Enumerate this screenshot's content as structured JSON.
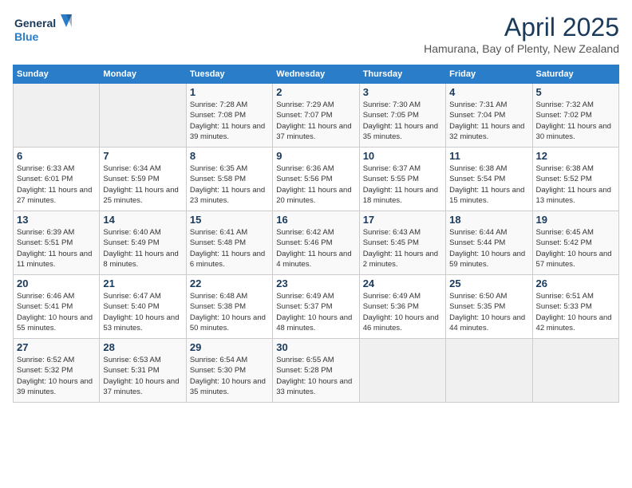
{
  "header": {
    "logo_line1": "General",
    "logo_line2": "Blue",
    "month": "April 2025",
    "location": "Hamurana, Bay of Plenty, New Zealand"
  },
  "days_of_week": [
    "Sunday",
    "Monday",
    "Tuesday",
    "Wednesday",
    "Thursday",
    "Friday",
    "Saturday"
  ],
  "weeks": [
    [
      {
        "day": "",
        "info": ""
      },
      {
        "day": "",
        "info": ""
      },
      {
        "day": "1",
        "info": "Sunrise: 7:28 AM\nSunset: 7:08 PM\nDaylight: 11 hours and 39 minutes."
      },
      {
        "day": "2",
        "info": "Sunrise: 7:29 AM\nSunset: 7:07 PM\nDaylight: 11 hours and 37 minutes."
      },
      {
        "day": "3",
        "info": "Sunrise: 7:30 AM\nSunset: 7:05 PM\nDaylight: 11 hours and 35 minutes."
      },
      {
        "day": "4",
        "info": "Sunrise: 7:31 AM\nSunset: 7:04 PM\nDaylight: 11 hours and 32 minutes."
      },
      {
        "day": "5",
        "info": "Sunrise: 7:32 AM\nSunset: 7:02 PM\nDaylight: 11 hours and 30 minutes."
      }
    ],
    [
      {
        "day": "6",
        "info": "Sunrise: 6:33 AM\nSunset: 6:01 PM\nDaylight: 11 hours and 27 minutes."
      },
      {
        "day": "7",
        "info": "Sunrise: 6:34 AM\nSunset: 5:59 PM\nDaylight: 11 hours and 25 minutes."
      },
      {
        "day": "8",
        "info": "Sunrise: 6:35 AM\nSunset: 5:58 PM\nDaylight: 11 hours and 23 minutes."
      },
      {
        "day": "9",
        "info": "Sunrise: 6:36 AM\nSunset: 5:56 PM\nDaylight: 11 hours and 20 minutes."
      },
      {
        "day": "10",
        "info": "Sunrise: 6:37 AM\nSunset: 5:55 PM\nDaylight: 11 hours and 18 minutes."
      },
      {
        "day": "11",
        "info": "Sunrise: 6:38 AM\nSunset: 5:54 PM\nDaylight: 11 hours and 15 minutes."
      },
      {
        "day": "12",
        "info": "Sunrise: 6:38 AM\nSunset: 5:52 PM\nDaylight: 11 hours and 13 minutes."
      }
    ],
    [
      {
        "day": "13",
        "info": "Sunrise: 6:39 AM\nSunset: 5:51 PM\nDaylight: 11 hours and 11 minutes."
      },
      {
        "day": "14",
        "info": "Sunrise: 6:40 AM\nSunset: 5:49 PM\nDaylight: 11 hours and 8 minutes."
      },
      {
        "day": "15",
        "info": "Sunrise: 6:41 AM\nSunset: 5:48 PM\nDaylight: 11 hours and 6 minutes."
      },
      {
        "day": "16",
        "info": "Sunrise: 6:42 AM\nSunset: 5:46 PM\nDaylight: 11 hours and 4 minutes."
      },
      {
        "day": "17",
        "info": "Sunrise: 6:43 AM\nSunset: 5:45 PM\nDaylight: 11 hours and 2 minutes."
      },
      {
        "day": "18",
        "info": "Sunrise: 6:44 AM\nSunset: 5:44 PM\nDaylight: 10 hours and 59 minutes."
      },
      {
        "day": "19",
        "info": "Sunrise: 6:45 AM\nSunset: 5:42 PM\nDaylight: 10 hours and 57 minutes."
      }
    ],
    [
      {
        "day": "20",
        "info": "Sunrise: 6:46 AM\nSunset: 5:41 PM\nDaylight: 10 hours and 55 minutes."
      },
      {
        "day": "21",
        "info": "Sunrise: 6:47 AM\nSunset: 5:40 PM\nDaylight: 10 hours and 53 minutes."
      },
      {
        "day": "22",
        "info": "Sunrise: 6:48 AM\nSunset: 5:38 PM\nDaylight: 10 hours and 50 minutes."
      },
      {
        "day": "23",
        "info": "Sunrise: 6:49 AM\nSunset: 5:37 PM\nDaylight: 10 hours and 48 minutes."
      },
      {
        "day": "24",
        "info": "Sunrise: 6:49 AM\nSunset: 5:36 PM\nDaylight: 10 hours and 46 minutes."
      },
      {
        "day": "25",
        "info": "Sunrise: 6:50 AM\nSunset: 5:35 PM\nDaylight: 10 hours and 44 minutes."
      },
      {
        "day": "26",
        "info": "Sunrise: 6:51 AM\nSunset: 5:33 PM\nDaylight: 10 hours and 42 minutes."
      }
    ],
    [
      {
        "day": "27",
        "info": "Sunrise: 6:52 AM\nSunset: 5:32 PM\nDaylight: 10 hours and 39 minutes."
      },
      {
        "day": "28",
        "info": "Sunrise: 6:53 AM\nSunset: 5:31 PM\nDaylight: 10 hours and 37 minutes."
      },
      {
        "day": "29",
        "info": "Sunrise: 6:54 AM\nSunset: 5:30 PM\nDaylight: 10 hours and 35 minutes."
      },
      {
        "day": "30",
        "info": "Sunrise: 6:55 AM\nSunset: 5:28 PM\nDaylight: 10 hours and 33 minutes."
      },
      {
        "day": "",
        "info": ""
      },
      {
        "day": "",
        "info": ""
      },
      {
        "day": "",
        "info": ""
      }
    ]
  ]
}
